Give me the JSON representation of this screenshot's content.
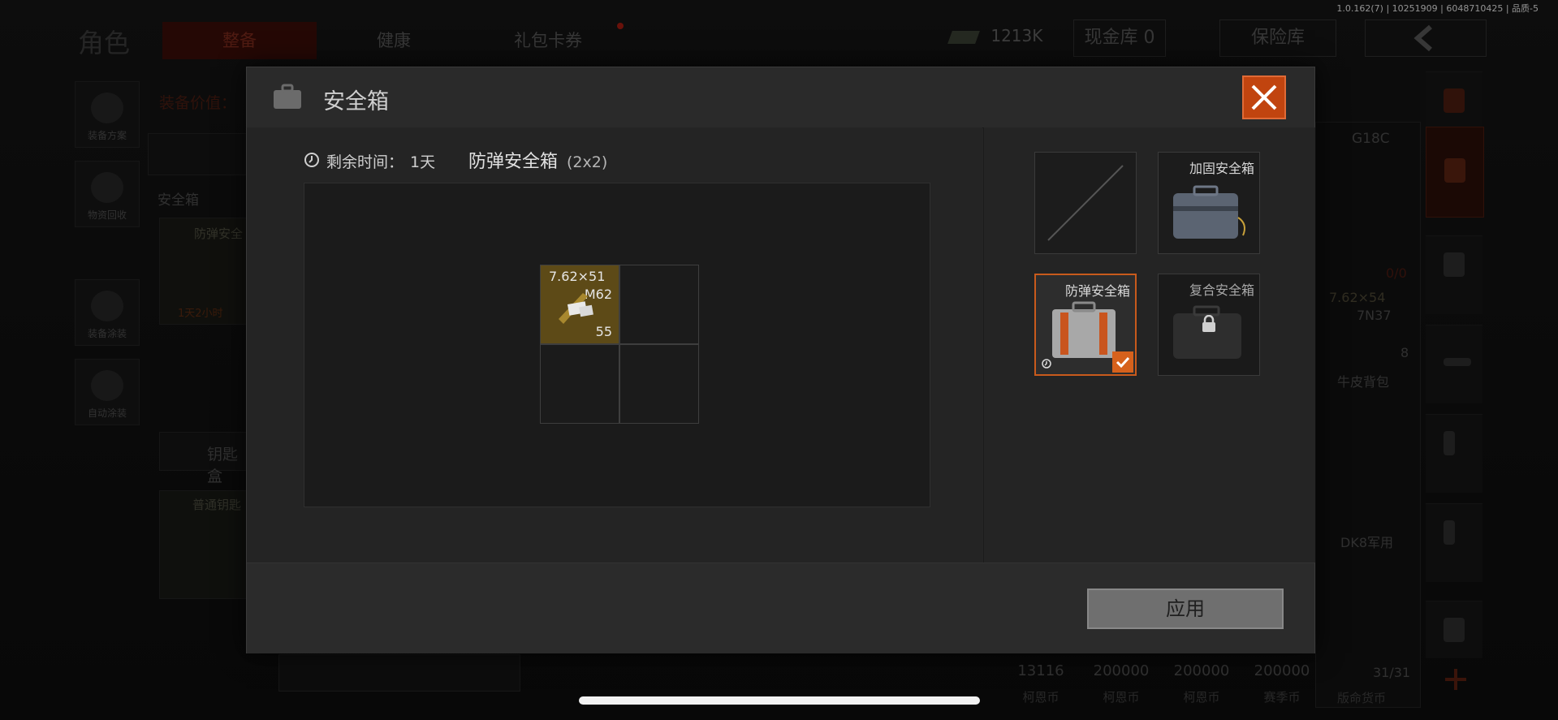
{
  "version_text": "1.0.162(7) | 10251909 | 6048710425 | 品质-5",
  "background": {
    "page_title": "角色",
    "tabs": [
      {
        "label": "整备",
        "active": true
      },
      {
        "label": "健康",
        "active": false
      },
      {
        "label": "礼包卡券",
        "active": false
      }
    ],
    "currency": {
      "amount": "1213K"
    },
    "cash_vault": "现金库 0",
    "insurance": "保险库",
    "equip_value_label": "装备价值：",
    "side_buttons": [
      "装备方案",
      "物资回收",
      "装备涂装",
      "自动涂装"
    ],
    "safe_box_label": "安全箱",
    "safe_box_item": "防弹安全",
    "safe_box_timer": "1天2小时",
    "key_label": "钥匙盒",
    "key_item": "普通钥匙",
    "right_panel": {
      "weapon": "G18C",
      "weapon_count": "0/0",
      "ammo_top": "7.62×54",
      "ammo_code": "7N37",
      "ammo_count": "8",
      "backpack": "牛皮背包",
      "vest": "DK8军用",
      "vest_count": "31/31",
      "vest_sub": "版命货币"
    },
    "shelf": [
      {
        "num": "13116",
        "label": "柯恩币"
      },
      {
        "num": "200000",
        "label": "柯恩币"
      },
      {
        "num": "200000",
        "label": "柯恩币"
      },
      {
        "num": "200000",
        "label": "赛季币"
      }
    ]
  },
  "modal": {
    "title": "安全箱",
    "remaining_label": "剩余时间：",
    "remaining_value": "1天",
    "case_name": "防弹安全箱",
    "case_size": "(2x2)",
    "ammo_item": {
      "caliber": "7.62×51",
      "type": "M62",
      "count": "55"
    },
    "case_options": [
      {
        "name": "",
        "state": "empty"
      },
      {
        "name": "加固安全箱",
        "state": "available"
      },
      {
        "name": "防弹安全箱",
        "state": "selected"
      },
      {
        "name": "复合安全箱",
        "state": "locked"
      }
    ],
    "apply_label": "应用"
  }
}
